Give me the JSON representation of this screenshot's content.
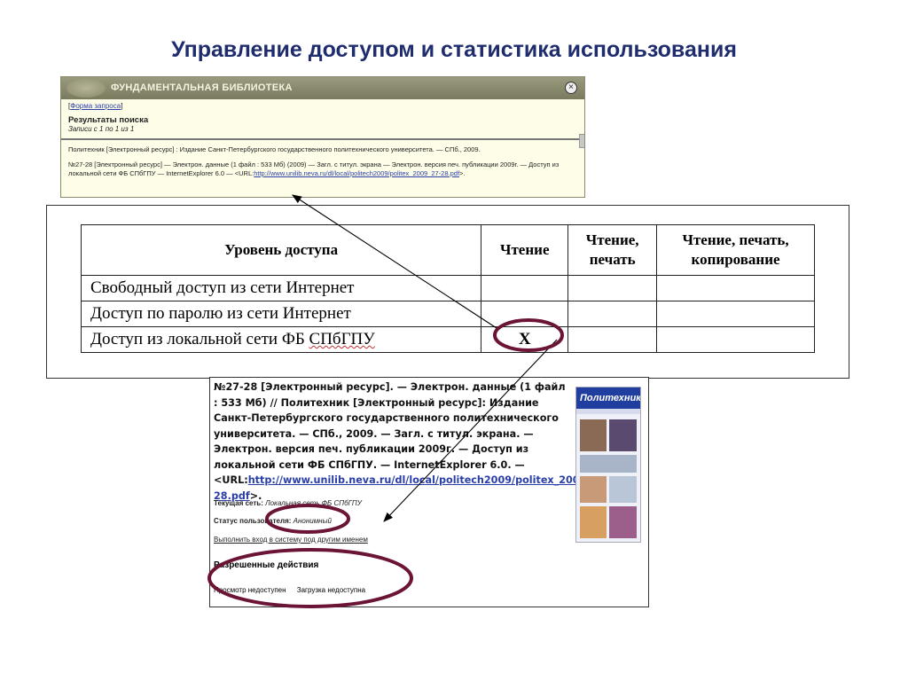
{
  "slide": {
    "title": "Управление доступом и статистика использования"
  },
  "library_window": {
    "name": "ФУНДАМЕНТАЛЬНАЯ БИБЛИОТЕКА",
    "close_icon": "close-icon",
    "bracket_open": "[",
    "form_link": "Форма запроса",
    "bracket_close": "]",
    "results_title": "Результаты поиска",
    "results_count": "Записи с 1 по 1 из 1",
    "line1": "Политехник [Электронный ресурс] : Издание Санкт-Петербургского государственного политехнического университета. — СПб., 2009.",
    "record_prefix": "№27-28 [Электронный ресурс] — Электрон. данные (1 файл : 533 Мб) (2009) — Загл. с титул. экрана — Электрон. версия печ. публикации 2009г. — Доступ из локальной сети ФБ СПбГПУ — InternetExplorer 6.0 — <URL:",
    "record_url": "http://www.unilib.neva.ru/dl/local/politech2009/politex_2009_27-28.pdf",
    "record_suffix": ">."
  },
  "access_table": {
    "headers": [
      "Уровень доступа",
      "Чтение",
      "Чтение, печать",
      "Чтение, печать, копирование"
    ],
    "rows": [
      {
        "level": "Свободный доступ из сети Интернет",
        "read": "",
        "read_print": "",
        "read_print_copy": ""
      },
      {
        "level": "Доступ по паролю из сети Интернет",
        "read": "",
        "read_print": "",
        "read_print_copy": ""
      },
      {
        "level_prefix": "Доступ из локальной сети ФБ ",
        "level_underlined": "СПбГПУ",
        "read": "Х",
        "read_print": "",
        "read_print_copy": ""
      }
    ]
  },
  "record_window": {
    "text_prefix": "№27-28 [Электронный ресурс]. — Электрон. данные (1 файл : 533 Мб) // Политехник [Электронный ресурс]: Издание Санкт-Петербургского государственного политехнического университета. — СПб., 2009. — Загл. с титул. экрана. — Электрон. версия печ. публикации 2009г. — Доступ из локальной сети ФБ СПбГПУ. — InternetExplorer 6.0. — <URL:",
    "url": "http://www.unilib.neva.ru/dl/local/politech2009/politex_2009_27-28.pdf",
    "text_suffix": ">.",
    "network_label": "Текущая сеть:",
    "network_value": "Локальная сеть ФБ СПбГПУ",
    "status_label": "Статус пользователя:",
    "status_value": "Анонимный",
    "login_link": "Выполнить вход в систему под другим именем",
    "allowed_title": "Разрешенные действия",
    "action_view": "Просмотр недоступен",
    "action_download": "Загрузка недоступна",
    "cover_title": "Политехник"
  },
  "colors": {
    "title": "#1f2d6e",
    "ellipse": "#6b1436",
    "link": "#2a3fa8"
  }
}
